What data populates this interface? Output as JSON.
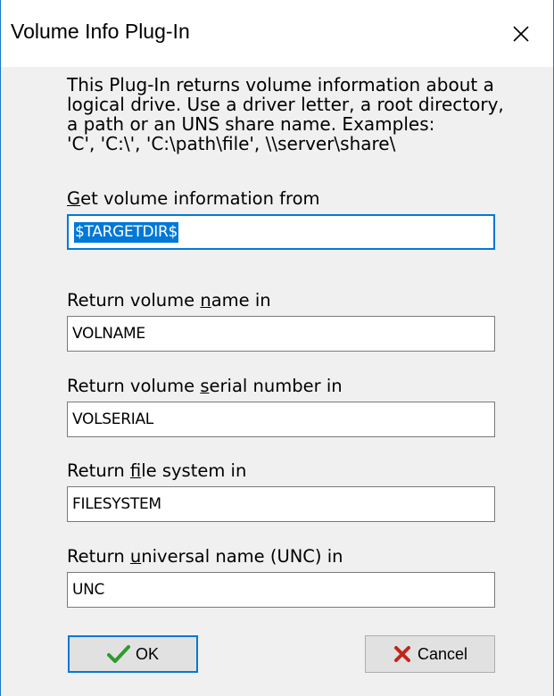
{
  "window": {
    "title": "Volume Info Plug-In",
    "close_icon": "close-icon"
  },
  "description": {
    "lines": [
      "This Plug-In returns volume information about a",
      "logical drive. Use a driver letter, a root directory,",
      "a path or an UNS share name. Examples:",
      "'C', 'C:\\', 'C:\\path\\file', \\\\server\\share\\"
    ]
  },
  "fields": [
    {
      "label_pre": "",
      "label_accel": "G",
      "label_post": "et volume information from",
      "value": "$TARGETDIR$"
    },
    {
      "label_pre": "Return volume ",
      "label_accel": "n",
      "label_post": "ame in",
      "value": "VOLNAME"
    },
    {
      "label_pre": "Return volume ",
      "label_accel": "s",
      "label_post": "erial number in",
      "value": "VOLSERIAL"
    },
    {
      "label_pre": "Return ",
      "label_accel": "f",
      "label_post": "ile system in",
      "value": "FILESYSTEM"
    },
    {
      "label_pre": "Return ",
      "label_accel": "u",
      "label_post": "niversal name (UNC) in",
      "value": "UNC"
    }
  ],
  "buttons": {
    "ok_label": "OK",
    "ok_icon": "checkmark-icon",
    "cancel_label": "Cancel",
    "cancel_icon": "x-icon"
  },
  "colors": {
    "accent": "#0078d7",
    "check": "#2e9a2e",
    "cancel_x": "#c0261b"
  }
}
